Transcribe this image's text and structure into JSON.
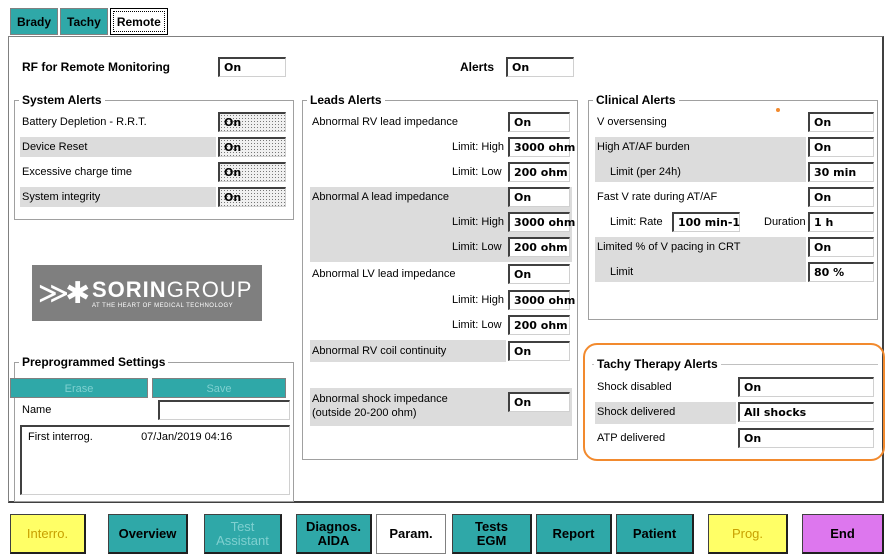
{
  "tabs": [
    {
      "label": "Brady"
    },
    {
      "label": "Tachy"
    },
    {
      "label": "Remote"
    }
  ],
  "rf": {
    "label": "RF for Remote Monitoring",
    "value": "On"
  },
  "alerts": {
    "label": "Alerts",
    "value": "On"
  },
  "system_alerts": {
    "title": "System Alerts",
    "items": [
      {
        "label": "Battery Depletion - R.R.T.",
        "value": "On"
      },
      {
        "label": "Device Reset",
        "value": "On"
      },
      {
        "label": "Excessive charge time",
        "value": "On"
      },
      {
        "label": "System integrity",
        "value": "On"
      }
    ]
  },
  "leads_alerts": {
    "title": "Leads Alerts",
    "rv_imp": {
      "label": "Abnormal RV lead impedance",
      "value": "On",
      "high_label": "Limit: High",
      "high": "3000 ohm",
      "low_label": "Limit: Low",
      "low": "200 ohm"
    },
    "a_imp": {
      "label": "Abnormal A lead impedance",
      "value": "On",
      "high_label": "Limit: High",
      "high": "3000 ohm",
      "low_label": "Limit: Low",
      "low": "200 ohm"
    },
    "lv_imp": {
      "label": "Abnormal LV lead impedance",
      "value": "On",
      "high_label": "Limit: High",
      "high": "3000 ohm",
      "low_label": "Limit: Low",
      "low": "200 ohm"
    },
    "rv_coil": {
      "label": "Abnormal RV coil continuity",
      "value": "On"
    },
    "shock_imp": {
      "label1": "Abnormal shock impedance",
      "label2": "(outside 20-200 ohm)",
      "value": "On"
    }
  },
  "clinical_alerts": {
    "title": "Clinical Alerts",
    "v_oversensing": {
      "label": "V oversensing",
      "value": "On"
    },
    "high_atf": {
      "label": "High AT/AF burden",
      "value": "On",
      "limit_label": "Limit (per 24h)",
      "limit": "30 min"
    },
    "fast_v": {
      "label": "Fast V rate during AT/AF",
      "value": "On",
      "rate_label": "Limit: Rate",
      "rate": "100 min-1",
      "duration_label": "Duration",
      "duration": "1 h"
    },
    "limited_v": {
      "label": "Limited % of V pacing in CRT",
      "value": "On",
      "limit_label": "Limit",
      "limit": "80 %"
    }
  },
  "tachy_alerts": {
    "title": "Tachy Therapy Alerts",
    "items": [
      {
        "label": "Shock disabled",
        "value": "On"
      },
      {
        "label": "Shock delivered",
        "value": "All shocks"
      },
      {
        "label": "ATP delivered",
        "value": "On"
      }
    ]
  },
  "logo": {
    "name_bold": "SORIN",
    "name_light": "GROUP",
    "tagline": "AT THE HEART OF MEDICAL TECHNOLOGY"
  },
  "preprogrammed": {
    "title": "Preprogrammed Settings",
    "erase_label": "Erase",
    "save_label": "Save",
    "name_label": "Name",
    "name_value": "",
    "list": [
      {
        "name": "First interrog.",
        "date": "07/Jan/2019 04:16"
      }
    ]
  },
  "footer": {
    "interro": "Interro.",
    "overview": "Overview",
    "test_assistant_1": "Test",
    "test_assistant_2": "Assistant",
    "diagnos_1": "Diagnos.",
    "diagnos_2": "AIDA",
    "param": "Param.",
    "tests_1": "Tests",
    "tests_2": "EGM",
    "report": "Report",
    "patient": "Patient",
    "prog": "Prog.",
    "end": "End"
  },
  "colors": {
    "teal": "#2fa8a8",
    "highlight_orange": "#f28a2e",
    "yellow": "#ffff66",
    "magenta": "#dd77ee"
  }
}
